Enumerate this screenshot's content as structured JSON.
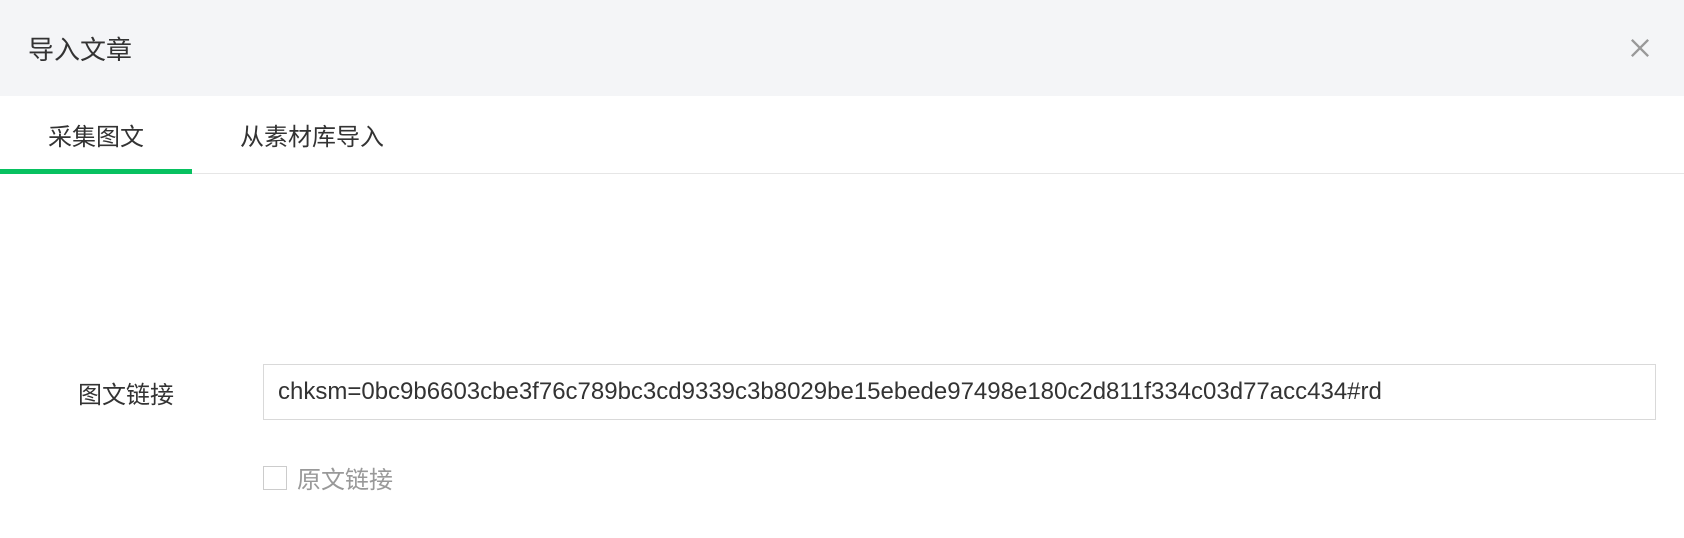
{
  "header": {
    "title": "导入文章"
  },
  "tabs": {
    "collect": "采集图文",
    "material": "从素材库导入"
  },
  "form": {
    "url_label": "图文链接",
    "url_value": "chksm=0bc9b6603cbe3f76c789bc3cd9339c3b8029be15ebede97498e180c2d811f334c03d77acc434#rd",
    "source_link_label": "原文链接"
  }
}
